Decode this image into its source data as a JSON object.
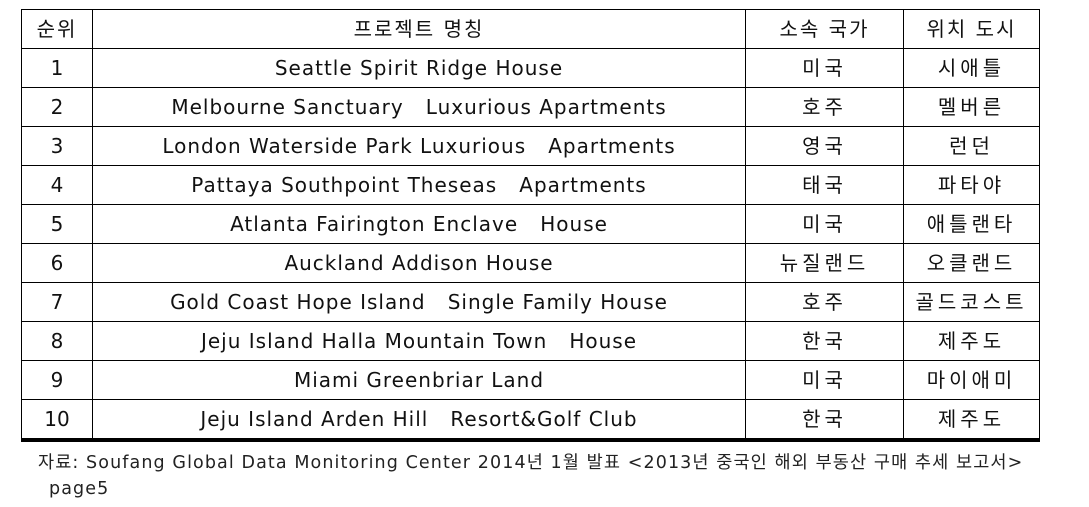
{
  "table": {
    "headers": {
      "rank": "순위",
      "project_name": "프로젝트 명칭",
      "country": "소속 국가",
      "city": "위치 도시"
    },
    "rows": [
      {
        "rank": "1",
        "project_name": "Seattle Spirit Ridge House",
        "country": "미국",
        "city": "시애틀"
      },
      {
        "rank": "2",
        "project_name": "Melbourne Sanctuary   Luxurious Apartments",
        "country": "호주",
        "city": "멜버른"
      },
      {
        "rank": "3",
        "project_name": "London Waterside Park Luxurious   Apartments",
        "country": "영국",
        "city": "런던"
      },
      {
        "rank": "4",
        "project_name": "Pattaya Southpoint Theseas   Apartments",
        "country": "태국",
        "city": "파타야"
      },
      {
        "rank": "5",
        "project_name": "Atlanta Fairington Enclave   House",
        "country": "미국",
        "city": "애틀랜타"
      },
      {
        "rank": "6",
        "project_name": "Auckland Addison House",
        "country": "뉴질랜드",
        "city": "오클랜드"
      },
      {
        "rank": "7",
        "project_name": "Gold Coast Hope Island   Single Family House",
        "country": "호주",
        "city": "골드코스트"
      },
      {
        "rank": "8",
        "project_name": "Jeju Island Halla Mountain Town   House",
        "country": "한국",
        "city": "제주도"
      },
      {
        "rank": "9",
        "project_name": "Miami Greenbriar Land",
        "country": "미국",
        "city": "마이애미"
      },
      {
        "rank": "10",
        "project_name": "Jeju Island Arden Hill   Resort&Golf Club",
        "country": "한국",
        "city": "제주도"
      }
    ]
  },
  "source_note": "자료: Soufang Global Data Monitoring Center 2014년 1월 발표 <2013년 중국인 해외 부동산 구매 추세 보고서> page5"
}
